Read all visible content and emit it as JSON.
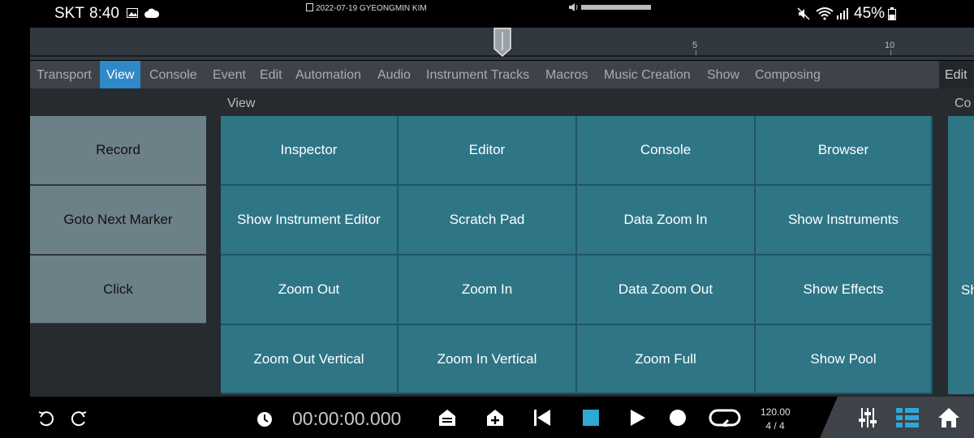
{
  "status_bar": {
    "carrier": "SKT",
    "time": "8:40",
    "watermark": "2022-07-19 GYEONGMIN KIM",
    "volume_level": 1.0,
    "battery": "45%",
    "icons": [
      "image-icon",
      "cloud-icon",
      "volume-icon",
      "mute-icon",
      "wifi-icon",
      "signal-icon",
      "battery-icon"
    ]
  },
  "timeline": {
    "labels": [
      "5",
      "10"
    ]
  },
  "menu": {
    "items": [
      "Transport",
      "View",
      "Console",
      "Event",
      "Edit",
      "Automation",
      "Audio",
      "Instrument Tracks",
      "Macros",
      "Music Creation",
      "Show",
      "Composing"
    ],
    "active": "View",
    "right_label": "Edit"
  },
  "left_panel": {
    "buttons": [
      "Record",
      "Goto Next Marker",
      "Click"
    ]
  },
  "view_section": {
    "title": "View",
    "buttons": [
      [
        "Inspector",
        "Editor",
        "Console",
        "Browser"
      ],
      [
        "Show Instrument Editor",
        "Scratch Pad",
        "Data Zoom In",
        "Show Instruments"
      ],
      [
        "Zoom Out",
        "Zoom In",
        "Data Zoom Out",
        "Show Effects"
      ],
      [
        "Zoom Out Vertical",
        "Zoom In Vertical",
        "Zoom Full",
        "Show Pool"
      ]
    ]
  },
  "right_section": {
    "title": "Co",
    "partial_button": "Sh"
  },
  "transport": {
    "time": "00:00:00.000",
    "tempo": "120.00",
    "signature": "4 / 4",
    "accent_color": "#2fa8d6"
  }
}
